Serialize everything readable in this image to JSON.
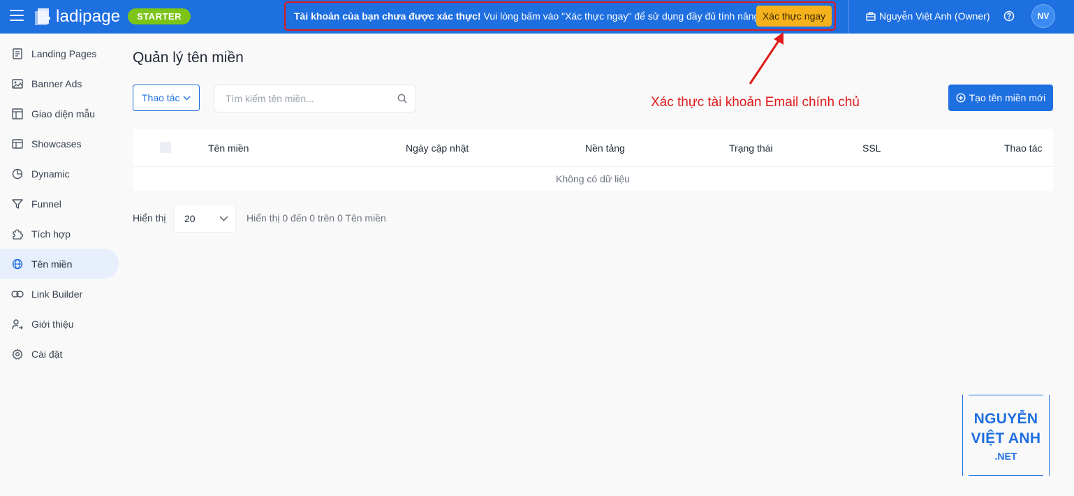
{
  "header": {
    "logo_text": "ladipage",
    "plan_badge": "STARTER",
    "banner_bold": "Tài khoản của bạn chưa được xác thực!",
    "banner_text": "Vui lòng bấm vào \"Xác thực ngay\" để sử dụng đầy đủ tính năng.",
    "verify_button": "Xác thực ngay",
    "owner_name": "Nguyễn Việt Anh (Owner)",
    "avatar_initials": "NV"
  },
  "sidebar": {
    "items": [
      {
        "label": "Landing Pages",
        "icon": "document-icon"
      },
      {
        "label": "Banner Ads",
        "icon": "image-icon"
      },
      {
        "label": "Giao diện mẫu",
        "icon": "template-icon"
      },
      {
        "label": "Showcases",
        "icon": "layout-icon"
      },
      {
        "label": "Dynamic",
        "icon": "pie-chart-icon"
      },
      {
        "label": "Funnel",
        "icon": "funnel-icon"
      },
      {
        "label": "Tích hợp",
        "icon": "puzzle-icon"
      },
      {
        "label": "Tên miền",
        "icon": "globe-icon",
        "active": true
      },
      {
        "label": "Link Builder",
        "icon": "link-icon"
      },
      {
        "label": "Giới thiệu",
        "icon": "user-referral-icon"
      },
      {
        "label": "Cài đặt",
        "icon": "gear-icon"
      }
    ]
  },
  "main": {
    "title": "Quản lý tên miền",
    "action_dropdown": "Thao tác",
    "search_placeholder": "Tìm kiếm tên miền...",
    "create_button": "Tạo tên miền mới",
    "annotation": "Xác thực tài khoản Email chính chủ",
    "table": {
      "columns": [
        "Tên miền",
        "Ngày cập nhật",
        "Nền tảng",
        "Trạng thái",
        "SSL",
        "Thao tác"
      ],
      "empty_text": "Không có dữ liệu"
    },
    "pagination": {
      "label": "Hiển thị",
      "page_size": "20",
      "info": "Hiển thị 0 đến 0 trên 0 Tên miền"
    }
  },
  "watermark": {
    "line1": "NGUYỄN",
    "line2": "VIỆT ANH",
    "line3": ".NET"
  },
  "colors": {
    "primary": "#1e6fe0",
    "badge_green": "#7cc417",
    "verify_yellow": "#f5b21c",
    "annotation_red": "#e01b1b"
  }
}
